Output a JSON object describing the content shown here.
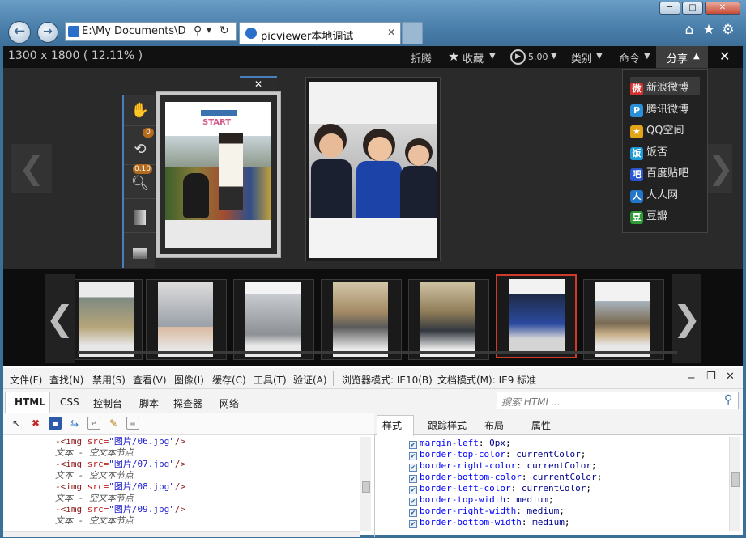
{
  "window": {
    "min_label": "─",
    "max_label": "□",
    "close_label": "✕"
  },
  "browser": {
    "back_glyph": "←",
    "forward_glyph": "→",
    "address": "E:\\My Documents\\Des",
    "search_glyph": "⚲",
    "dropdown_glyph": "▾",
    "refresh_glyph": "↻",
    "tab_title": "picviewer本地调试",
    "tab_close": "✕",
    "home_glyph": "⌂",
    "fav_glyph": "★",
    "settings_glyph": "⚙"
  },
  "viewer": {
    "dimensions": "1300 x 1800",
    "zoom": "( 12.11% )",
    "menu": {
      "fold": "折腾",
      "collect": "收藏",
      "collect_arrow": "▼",
      "play_speed": "5.00",
      "play_arrow": "▼",
      "category": "类别",
      "category_arrow": "▼",
      "command": "命令",
      "command_arrow": "▼",
      "share": "分享",
      "share_arrow": "▲",
      "close": "✕"
    },
    "share_menu": [
      {
        "label": "新浪微博",
        "icon": "weibo-icon",
        "color": "#d62f2f",
        "glyph": "微"
      },
      {
        "label": "腾讯微博",
        "icon": "tencent-weibo-icon",
        "color": "#2b8fd8",
        "glyph": "P"
      },
      {
        "label": "QQ空间",
        "icon": "qzone-icon",
        "color": "#e2a418",
        "glyph": "★"
      },
      {
        "label": "饭否",
        "icon": "fanfou-icon",
        "color": "#1d9bd8",
        "glyph": "饭"
      },
      {
        "label": "百度贴吧",
        "icon": "tieba-icon",
        "color": "#2a58d0",
        "glyph": "吧"
      },
      {
        "label": "人人网",
        "icon": "renren-icon",
        "color": "#2277c8",
        "glyph": "人"
      },
      {
        "label": "豆瓣",
        "icon": "douban-icon",
        "color": "#2d9b36",
        "glyph": "豆"
      }
    ],
    "tool_badges": {
      "rotate_count": "0",
      "zoom_value": "0.10"
    },
    "prev_glyph": "❮",
    "next_glyph": "❯",
    "gallery_close": "✕",
    "slide_text": "START"
  },
  "filmstrip": {
    "count": 7,
    "selected_index": 5,
    "prev_glyph": "❮",
    "next_glyph": "❯"
  },
  "devtools": {
    "menu": [
      "文件(F)",
      "查找(N)",
      "禁用(S)",
      "查看(V)",
      "图像(I)",
      "缓存(C)",
      "工具(T)",
      "验证(A)",
      "浏览器模式: IE10(B)",
      "文档模式(M): IE9 标准"
    ],
    "tabs": [
      "HTML",
      "CSS",
      "控制台",
      "脚本",
      "探查器",
      "网络"
    ],
    "active_tab": "HTML",
    "search_placeholder": "搜索 HTML...",
    "right_tabs": [
      "样式",
      "跟踪样式",
      "布局",
      "属性"
    ],
    "active_right_tab": "样式",
    "code_lines": [
      {
        "kind": "tag",
        "src": "图片/06.jpg"
      },
      {
        "kind": "text",
        "text": "文本 - 空文本节点"
      },
      {
        "kind": "tag",
        "src": "图片/07.jpg"
      },
      {
        "kind": "text",
        "text": "文本 - 空文本节点"
      },
      {
        "kind": "tag",
        "src": "图片/08.jpg"
      },
      {
        "kind": "text",
        "text": "文本 - 空文本节点"
      },
      {
        "kind": "tag",
        "src": "图片/09.jpg"
      },
      {
        "kind": "text",
        "text": "文本 - 空文本节点"
      }
    ],
    "css_props": [
      {
        "prop": "margin-left",
        "value": "0px"
      },
      {
        "prop": "border-top-color",
        "value": "currentColor"
      },
      {
        "prop": "border-right-color",
        "value": "currentColor"
      },
      {
        "prop": "border-bottom-color",
        "value": "currentColor"
      },
      {
        "prop": "border-left-color",
        "value": "currentColor"
      },
      {
        "prop": "border-top-width",
        "value": "medium"
      },
      {
        "prop": "border-right-width",
        "value": "medium"
      },
      {
        "prop": "border-bottom-width",
        "value": "medium"
      }
    ]
  },
  "colors": {
    "accent": "#4a7fbd",
    "selected_thumb": "#d03a2a",
    "css_prop": "#0000ff",
    "css_value": "#00008b"
  }
}
